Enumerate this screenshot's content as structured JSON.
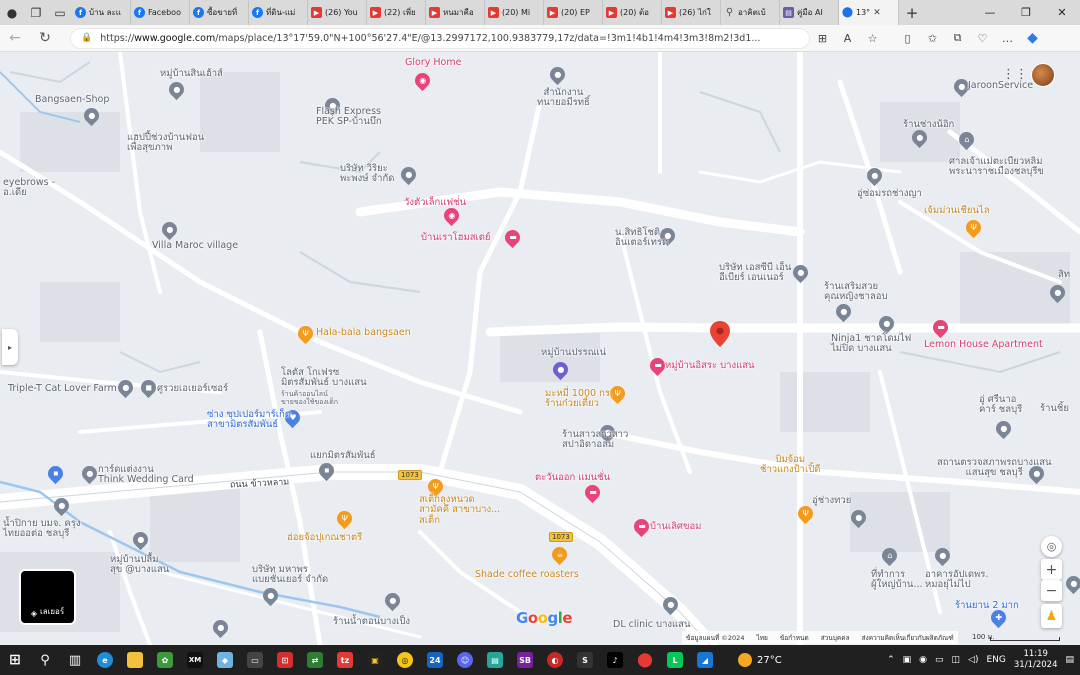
{
  "browser": {
    "tabs": [
      {
        "icon": "facebook-icon",
        "label": "บ้าน ละแ",
        "kind": "fb"
      },
      {
        "icon": "facebook-icon",
        "label": "Faceboo",
        "kind": "fb"
      },
      {
        "icon": "facebook-icon",
        "label": "ซื้อขายที่",
        "kind": "fb"
      },
      {
        "icon": "facebook-icon",
        "label": "ที่ดิน-แม่",
        "kind": "fb"
      },
      {
        "icon": "youtube-icon",
        "label": "(26) You",
        "kind": "yt"
      },
      {
        "icon": "youtube-icon",
        "label": "(22) เพี่ย",
        "kind": "yt"
      },
      {
        "icon": "youtube-icon",
        "label": "หนมาคือ",
        "kind": "yt"
      },
      {
        "icon": "youtube-icon",
        "label": "(20) Mi",
        "kind": "yt"
      },
      {
        "icon": "youtube-icon",
        "label": "(20) EP",
        "kind": "yt"
      },
      {
        "icon": "youtube-icon",
        "label": "(20) ต้อ",
        "kind": "yt"
      },
      {
        "icon": "youtube-icon",
        "label": "(26) ไก่ใ",
        "kind": "yt"
      },
      {
        "icon": "search-icon",
        "label": "อาคิตเบ้",
        "kind": "srch"
      },
      {
        "icon": "document-icon",
        "label": "คู่มือ AI",
        "kind": "doc"
      },
      {
        "icon": "maps-icon",
        "label": "13°",
        "kind": "map",
        "active": true
      }
    ],
    "url_prefix": "https://",
    "url_host": "www.google.com",
    "url_path": "/maps/place/13°17'59.0\"N+100°56'27.4\"E/@13.2997172,100.9383779,17z/data=!3m1!4b1!4m4!3m3!8m2!3d1..."
  },
  "map": {
    "labels": [
      {
        "text": "Bangsaen-Shop",
        "style": ""
      },
      {
        "text": "หมู่บ้านสินเฮ้าส์",
        "style": ""
      },
      {
        "text": "Glory Home",
        "style": "pink"
      },
      {
        "text": "สำนักงาน\nทนายอมีรทธิ์",
        "style": ""
      },
      {
        "text": "Flash Express\nPEK SP-บ้านบึก",
        "style": ""
      },
      {
        "text": "JaroonService",
        "style": ""
      },
      {
        "text": "แฮปปี้ช่วงบ้านฟอน\nเพื่อสุขภาพ",
        "style": ""
      },
      {
        "text": "eyebrows -\nอ.เดีย",
        "style": ""
      },
      {
        "text": "บริษัท วิริยะ\nพะพงษ์ จำกัด",
        "style": ""
      },
      {
        "text": "ร้านช่างน้อิก",
        "style": ""
      },
      {
        "text": "ศาลเจ้าแม่ตะเบียวหลิม\nพระนาราชเมืองชลบุรีข",
        "style": ""
      },
      {
        "text": "อู่ซ่อมรถช่างญา",
        "style": ""
      },
      {
        "text": "เจ้มม่วนเชียนไล",
        "style": "orange"
      },
      {
        "text": "วังตัวเล็กแฟช่่น",
        "style": "pink"
      },
      {
        "text": "บ้านเราโฮมสเตย์",
        "style": "pink"
      },
      {
        "text": "น.สิทธิโชติ\nอินเตอร์เทรด",
        "style": ""
      },
      {
        "text": "Villa Maroc village",
        "style": ""
      },
      {
        "text": "บริษัท เอสซีบี เอ็น\nอีเบียร์ เอนเนอร์",
        "style": ""
      },
      {
        "text": "ร้านเสริมสวย\nคุณหญิงชาลอบ",
        "style": ""
      },
      {
        "text": "Hala-bala bangsaen",
        "style": "orange"
      },
      {
        "text": "Ninja1 ชาดโดมไฟ\nไม่ปิด บางแสน",
        "style": ""
      },
      {
        "text": "Lemon House Apartment",
        "style": "pink"
      },
      {
        "text": "โลตัส โกเฟรซ\nมิตรสัมพันธ์ บางแสน",
        "style": ""
      },
      {
        "text": "ร้านค้าออนไลน์\nขายของใช้ของเด็ก",
        "style": ""
      },
      {
        "text": "หมู่บ้านปรรณเน่",
        "style": ""
      },
      {
        "text": "หมู่บ้านอิสระ บางแสน",
        "style": "pink"
      },
      {
        "text": "Triple-T Cat Lover Farm",
        "style": ""
      },
      {
        "text": "ศูรวยเอเยอร์เซอร์",
        "style": ""
      },
      {
        "text": "ซ่าง ซุปเปอร์มาร์เก็ต\nสาขามิตรสัมพันธ์",
        "style": "blue"
      },
      {
        "text": "มะหมี่ 1000 กร.\nร้านก๋วยเตี๋ยว",
        "style": "orange"
      },
      {
        "text": "อู่ ศรีนาอ\nคาร์ ชลบุรี",
        "style": ""
      },
      {
        "text": "ร้านสาวลาวสาว\nสปาอิดาอลม",
        "style": ""
      },
      {
        "text": "แยกมิตรสัมพันธ์",
        "style": ""
      },
      {
        "text": "การ์ดแต่งงาน\nThink Wedding Card",
        "style": ""
      },
      {
        "text": "ตะวันออก แมนชั่น",
        "style": "pink"
      },
      {
        "text": "บิมจ้อม\nช้าวแกงป้าเปิ้ดี",
        "style": "orange"
      },
      {
        "text": "สถานตรวจสภาพรถบางแสน\nแสนสุข ชลบุรี",
        "style": ""
      },
      {
        "text": "ถนน ข้าวหลาม",
        "style": "road"
      },
      {
        "text": "สเต็กลุงหนวด\nสามัคคี สาขาบาง...\nสเต็ก",
        "style": "orange"
      },
      {
        "text": "อู่ช่างทวย",
        "style": ""
      },
      {
        "text": "น้ำปิกาย บมจ. ครุง\nไทยออต่อ ชลบุรี",
        "style": ""
      },
      {
        "text": "ฮ่อยจ้อปุเกณชาตรี",
        "style": "orange"
      },
      {
        "text": "บ้านเลิศขอม",
        "style": "pink"
      },
      {
        "text": "หมู่บ้านปลื้ม\nสุข @บางแสน",
        "style": ""
      },
      {
        "text": "Shade coffee roasters",
        "style": "orange"
      },
      {
        "text": "บริษัท มหาพร\nแบยชั่นเยอร์ จำกัด",
        "style": ""
      },
      {
        "text": "ที่ทำการ\nผู้ใหญ่บ้าน...",
        "style": ""
      },
      {
        "text": "อาคารอัปเดพร.\nหมอยุ่ไม่ไป",
        "style": ""
      },
      {
        "text": "ร้านน้ำตอนบางเป็ง",
        "style": ""
      },
      {
        "text": "DL clinic บางแสน",
        "style": ""
      },
      {
        "text": "ร้านยาน 2 มาก",
        "style": "blue"
      },
      {
        "text": "ร้านชิ้ย",
        "style": ""
      },
      {
        "text": "สิท",
        "style": ""
      }
    ],
    "route_shields": [
      "1073",
      "1073"
    ],
    "logo": "Google",
    "layers_label": "เลเยอร์",
    "footer": [
      "ข้อมูลแผนที่ ©2024",
      "ไทย",
      "ข้อกำหนด",
      "ส่วนบุคคล",
      "ส่งความคิดเห็นเกี่ยวกับผลิตภัณฑ์",
      "100 ม."
    ]
  },
  "taskbar": {
    "temperature": "27°C",
    "language": "ENG",
    "time": "11:19",
    "date": "31/1/2024"
  }
}
